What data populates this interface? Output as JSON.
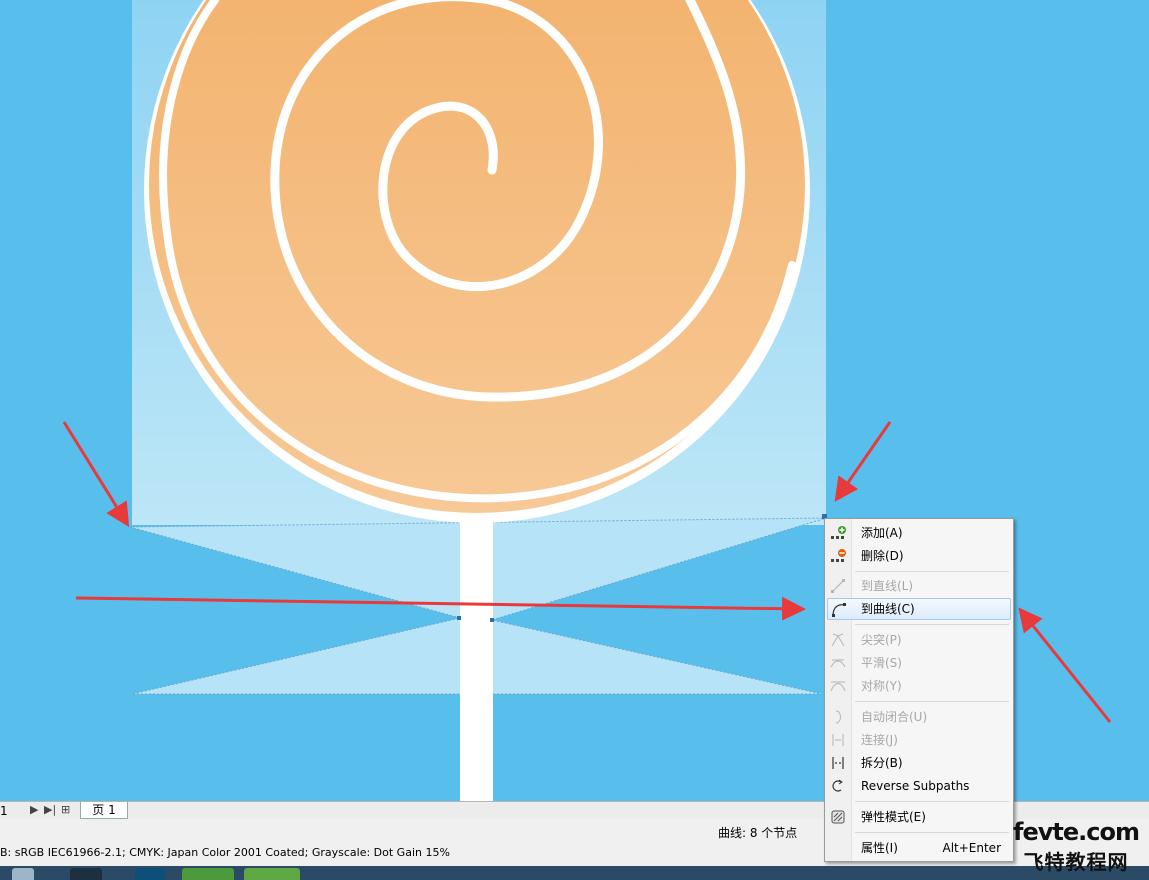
{
  "context_menu": {
    "items": [
      {
        "label": "添加(A)",
        "icon": "add-node-icon",
        "enabled": true
      },
      {
        "label": "删除(D)",
        "icon": "delete-node-icon",
        "enabled": true
      },
      {
        "label": "到直线(L)",
        "icon": "to-line-icon",
        "enabled": false
      },
      {
        "label": "到曲线(C)",
        "icon": "to-curve-icon",
        "enabled": true,
        "highlighted": true
      },
      {
        "label": "尖突(P)",
        "icon": "cusp-icon",
        "enabled": false
      },
      {
        "label": "平滑(S)",
        "icon": "smooth-icon",
        "enabled": false
      },
      {
        "label": "对称(Y)",
        "icon": "symmetrical-icon",
        "enabled": false
      },
      {
        "label": "自动闭合(U)",
        "icon": "auto-close-icon",
        "enabled": false
      },
      {
        "label": "连接(J)",
        "icon": "join-icon",
        "enabled": false
      },
      {
        "label": "拆分(B)",
        "icon": "break-icon",
        "enabled": true
      },
      {
        "label": "Reverse Subpaths",
        "icon": "reverse-subpaths-icon",
        "enabled": true
      },
      {
        "label": "弹性模式(E)",
        "icon": "elastic-mode-icon",
        "enabled": true
      },
      {
        "label": "属性(I)",
        "shortcut": "Alt+Enter",
        "enabled": true
      }
    ]
  },
  "page_bar": {
    "page_number": "1",
    "tab_label": "页 1"
  },
  "status_bar": {
    "selection_info": "曲线: 8 个节点",
    "color_profile": "B: sRGB IEC61966-2.1; CMYK: Japan Color 2001 Coated; Grayscale: Dot Gain 15%"
  },
  "watermark": {
    "line1": "fevte.com",
    "line2": "飞特教程网"
  },
  "colors": {
    "background": "#58bfed",
    "lollipop_top": "#f2ae66",
    "lollipop_bottom": "#f7c996",
    "arrow": "#e8393b",
    "menu_highlight": "#dcebfc"
  }
}
